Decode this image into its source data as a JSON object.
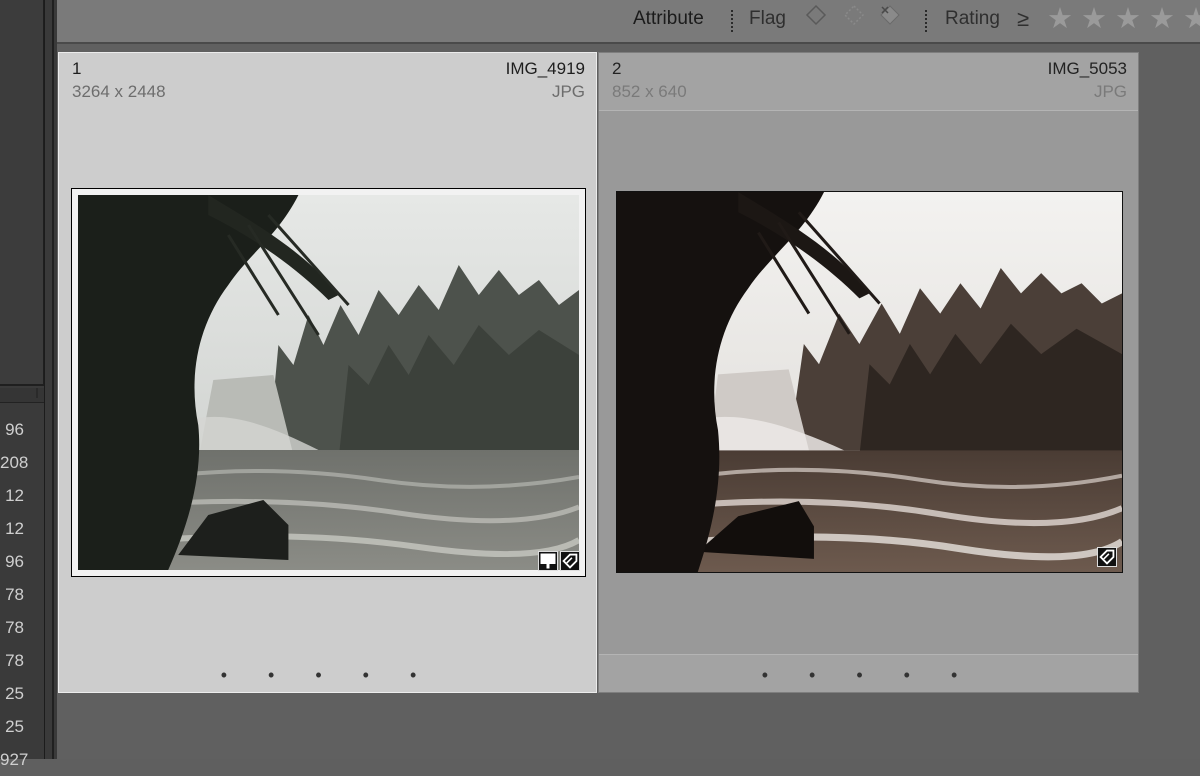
{
  "sidebar": {
    "counts": [
      "96",
      "208",
      "12",
      "12",
      "96",
      "78",
      "78",
      "78",
      "25",
      "25",
      "927"
    ]
  },
  "filter_bar": {
    "attribute_label": "Attribute",
    "flag_label": "Flag",
    "rating_label": "Rating",
    "rating_operator": "≥",
    "flag_icons": [
      "flag-unflagged-icon",
      "flag-any-icon",
      "flag-rejected-icon"
    ],
    "star_count": 5
  },
  "grid": {
    "cells": [
      {
        "index": "1",
        "filename": "IMG_4919",
        "dimensions": "3264 x 2448",
        "filetype": "JPG",
        "selected": true,
        "badges": [
          "comment-badge-icon",
          "metadata-badge-icon"
        ],
        "rating_dots": "• • • • •"
      },
      {
        "index": "2",
        "filename": "IMG_5053",
        "dimensions": "852 x 640",
        "filetype": "JPG",
        "selected": false,
        "badges": [
          "metadata-badge-icon"
        ],
        "rating_dots": "• • • • •"
      }
    ]
  },
  "colors": {
    "selected_cell": "#cdcdcd",
    "unselected_cell": "#999999",
    "filter_bar": "#7a7a7a",
    "star_inactive": "#9a9a9a"
  }
}
